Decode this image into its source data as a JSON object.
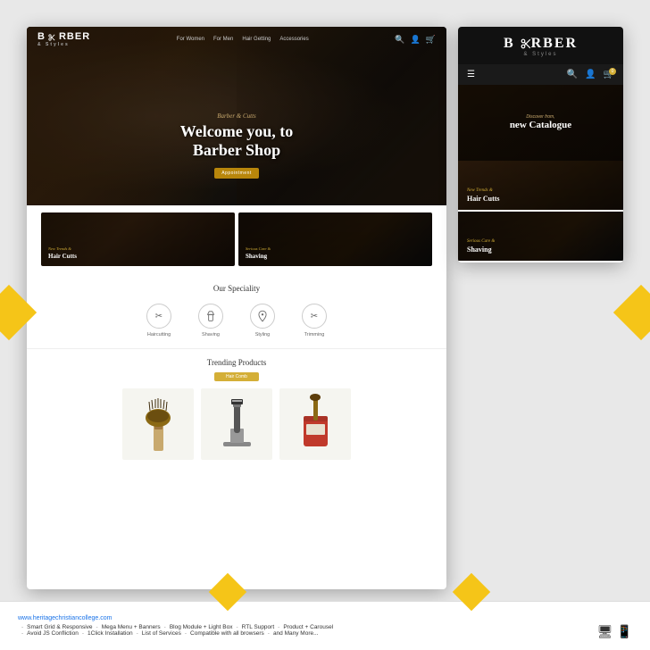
{
  "page": {
    "background_color": "#e0e0e0"
  },
  "desktop": {
    "navbar": {
      "logo": "BARBER",
      "logo_sub": "& Styles",
      "nav_items": [
        "For Women",
        "For Men",
        "Hair Getting",
        "Accessories"
      ],
      "icons": [
        "search",
        "user",
        "cart"
      ]
    },
    "hero": {
      "subtitle": "Barber & Cutts",
      "title": "Welcome you, to\nBarber Shop",
      "button_label": "Appointment"
    },
    "categories": [
      {
        "label": "New Trends &",
        "label2": "Hair Cutts"
      },
      {
        "label": "Serious Care &",
        "label2": "Shaving"
      }
    ],
    "speciality": {
      "title": "Our Speciality",
      "items": [
        {
          "icon": "✂",
          "label": "Haircutting"
        },
        {
          "icon": "🪒",
          "label": "Shaving"
        },
        {
          "icon": "💈",
          "label": "Styling"
        },
        {
          "icon": "✂",
          "label": "Trimming"
        }
      ]
    },
    "trending": {
      "title": "Trending Products",
      "filter_label": "Hair Comb",
      "products": [
        "brush",
        "razor",
        "bowl"
      ]
    }
  },
  "mobile": {
    "logo": "BARBER",
    "logo_sub": "& Styles",
    "hero": {
      "subtitle": "Discover from,",
      "title": "new Catalogue"
    },
    "categories": [
      {
        "label": "New Trends &",
        "label2": "Hair Cutts"
      },
      {
        "label": "Serious Care &",
        "label2": "Shaving"
      }
    ]
  },
  "bottom_bar": {
    "url": "www.heritagechristiancollege.com",
    "features": [
      "Smart Grid & Responsive",
      "Mega Menu + Banners",
      "Blog Module + Light Box",
      "RTL Support",
      "Product + Carousel",
      "Avoid JS Confliction",
      "1Click Installation",
      "List of Services",
      "Compatible with all browsers",
      "and Many More..."
    ],
    "separator": "-"
  }
}
